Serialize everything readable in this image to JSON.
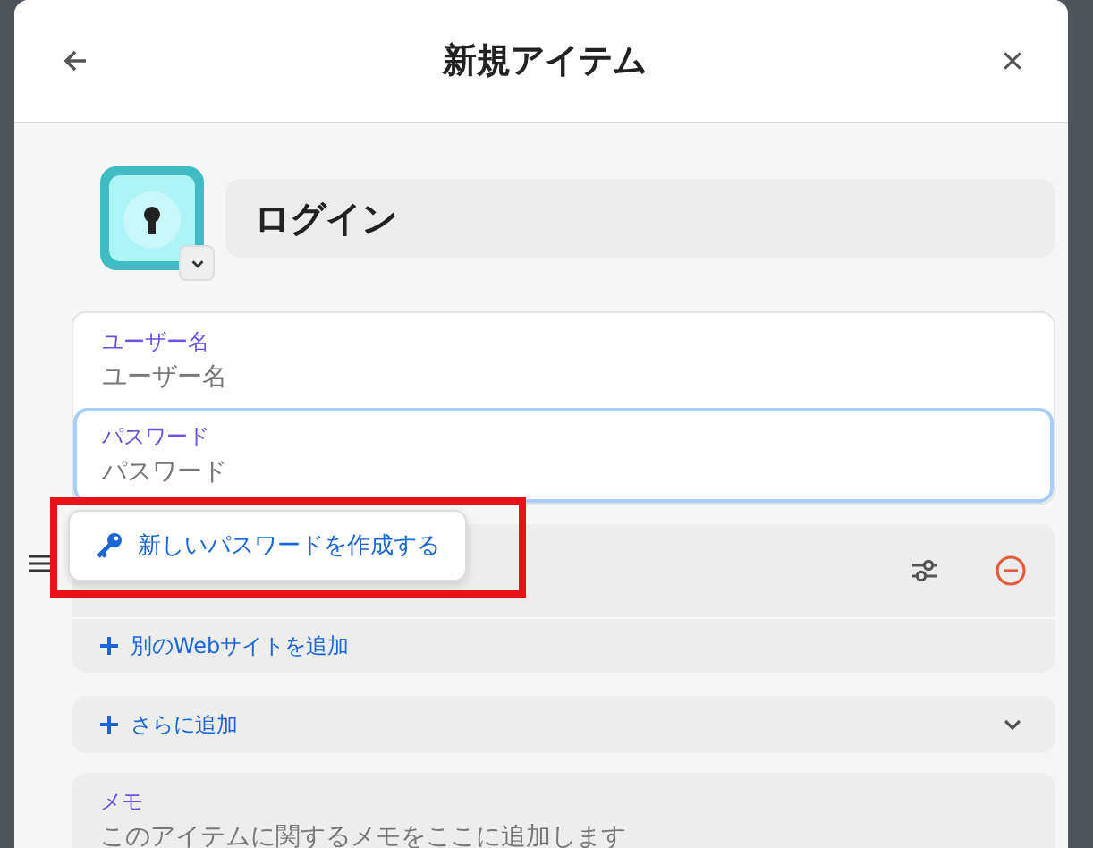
{
  "header": {
    "title": "新規アイテム"
  },
  "item": {
    "name": "ログイン"
  },
  "fields": [
    {
      "label": "ユーザー名",
      "placeholder": "ユーザー名",
      "focused": false
    },
    {
      "label": "パスワード",
      "placeholder": "パスワード",
      "focused": true
    }
  ],
  "popover": {
    "label": "新しいパスワードを作成する"
  },
  "website": {
    "add_label": "別のWebサイトを追加"
  },
  "more": {
    "label": "さらに追加",
    "expanded": false
  },
  "note": {
    "label": "メモ",
    "placeholder": "このアイテムに関するメモをここに追加します"
  }
}
